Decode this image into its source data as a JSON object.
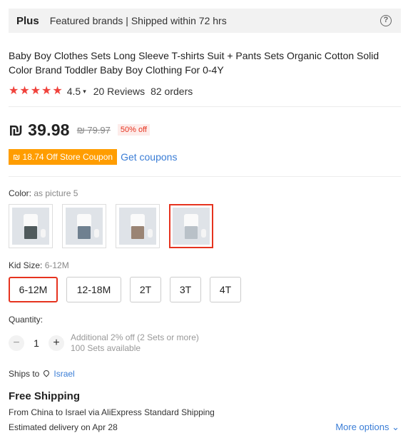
{
  "plus_bar": {
    "badge": "Plus",
    "text": "Featured brands | Shipped within 72 hrs",
    "help_icon": "question-circle-icon"
  },
  "product": {
    "title": "Baby Boy Clothes Sets Long Sleeve T-shirts Suit + Pants Sets Organic Cotton Solid Color Brand Toddler Baby Boy Clothing For 0-4Y",
    "rating": "4.5",
    "stars": 4.5,
    "reviews": "20 Reviews",
    "orders": "82 orders"
  },
  "price": {
    "current": "₪ 39.98",
    "original": "₪ 79.97",
    "discount": "50% off"
  },
  "coupon": {
    "label": "₪ 18.74 Off Store Coupon",
    "link": "Get coupons"
  },
  "color": {
    "label": "Color:",
    "value": "as picture 5",
    "selected_index": 3,
    "swatch_count": 4
  },
  "size": {
    "label": "Kid Size:",
    "value": "6-12M",
    "options": [
      "6-12M",
      "12-18M",
      "2T",
      "3T",
      "4T"
    ],
    "selected_index": 0
  },
  "quantity": {
    "label": "Quantity:",
    "value": "1",
    "minus": "−",
    "plus": "+",
    "note1": "Additional 2% off (2 Sets or more)",
    "note2": "100 Sets available"
  },
  "shipping": {
    "ships_to_label": "Ships to",
    "country": "Israel",
    "free": "Free Shipping",
    "from_text": "From China to Israel via AliExpress Standard Shipping",
    "estimated_prefix": "Estimated delivery on",
    "estimated_date": "Apr 28",
    "more_options": "More options"
  },
  "colors": {
    "accent_red": "#e6331f",
    "star_red": "#f0423c",
    "coupon_orange": "#ff9d00",
    "link_blue": "#3a7dd6"
  }
}
